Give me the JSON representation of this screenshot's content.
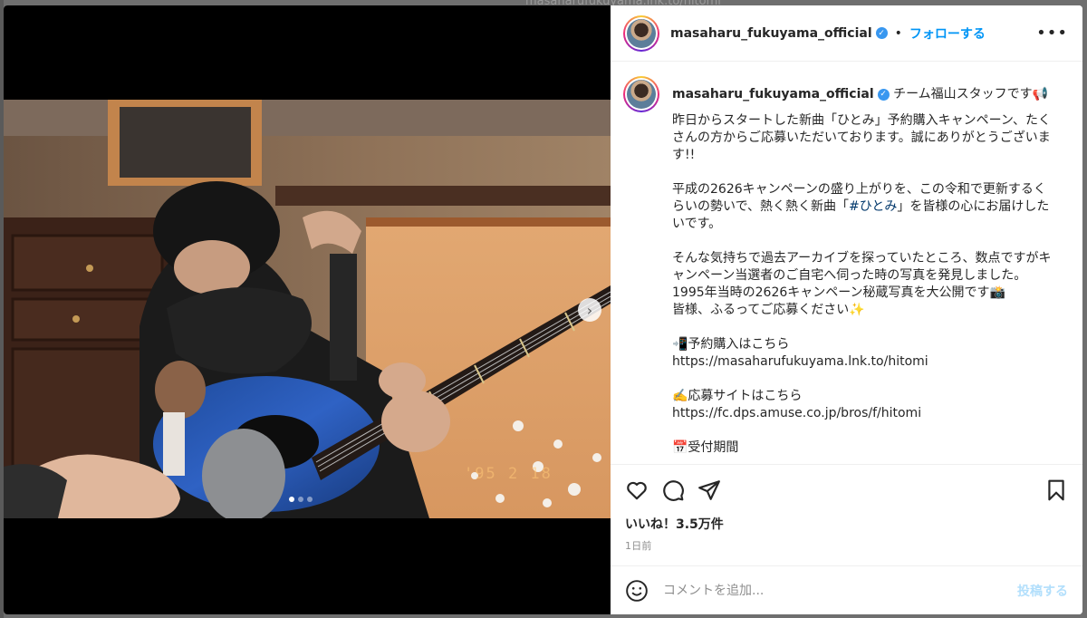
{
  "backdrop": {
    "text": "masaharufukuyama.lnk.to/hitomi"
  },
  "header": {
    "username": "masaharu_fukuyama_official",
    "separator": "•",
    "follow_label": "フォローする",
    "more_label": "•••"
  },
  "caption": {
    "username": "masaharu_fukuyama_official",
    "first_line": "チーム福山スタッフです📢",
    "paragraphs": [
      "昨日からスタートした新曲「ひとみ」予約購入キャンペーン、たくさんの方からご応募いただいております。誠にありがとうございます!!",
      "平成の2626キャンペーンの盛り上がりを、この令和で更新するくらいの勢いで、熱く熱く新曲「",
      "」を皆様の心にお届けしたいです。",
      "そんな気持ちで過去アーカイブを探っていたところ、数点ですがキャンペーン当選者のご自宅へ伺った時の写真を発見しました。\n1995年当時の2626キャンペーン秘蔵写真を大公開です📸\n皆様、ふるってご応募ください✨",
      "📲予約購入はこちら\nhttps://masaharufukuyama.lnk.to/hitomi",
      "✍️応募サイトはこちら\nhttps://fc.dps.amuse.co.jp/bros/f/hitomi",
      "📅受付期間"
    ],
    "hashtag": "#ひとみ"
  },
  "media": {
    "date_stamp": "'95 2 18",
    "slide_count": 3,
    "active_slide": 1
  },
  "actions": {
    "likes": "いいね！3.5万件",
    "time": "1日前"
  },
  "comment": {
    "placeholder": "コメントを追加...",
    "post_label": "投稿する"
  },
  "icons": [
    "heart-icon",
    "comment-icon",
    "share-icon",
    "bookmark-icon",
    "emoji-icon",
    "chevron-right-icon",
    "verified-icon"
  ],
  "colors": {
    "accent": "#0095f6",
    "verified": "#3897f0",
    "post_disabled": "#b2dffc"
  }
}
